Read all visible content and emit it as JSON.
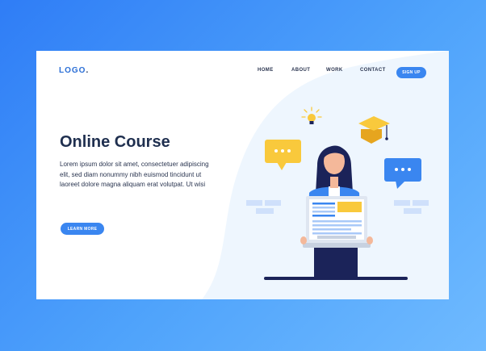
{
  "header": {
    "logo_text": "LOGO",
    "logo_dot": ".",
    "nav": [
      "HOME",
      "ABOUT",
      "WORK",
      "CONTACT"
    ],
    "signup_label": "SIGN UP"
  },
  "hero": {
    "title": "Online Course",
    "description": "Lorem ipsum dolor sit amet, consectetuer adipiscing elit, sed diam nonummy nibh euismod tincidunt ut laoreet dolore magna aliquam erat volutpat. Ut wisi",
    "cta_label": "LEARN MORE"
  },
  "colors": {
    "background": "#3a8cf7",
    "accent": "#3a86f0",
    "heading": "#1f2f4f",
    "bubble_yellow": "#f9c93c",
    "bubble_blue": "#3a86f0"
  },
  "illustration": {
    "icons": [
      "lightbulb-icon",
      "graduation-cap-icon",
      "chat-bubble-icon",
      "laptop-icon"
    ]
  }
}
